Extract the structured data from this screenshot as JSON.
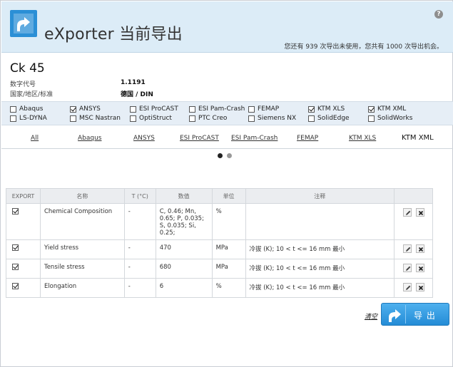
{
  "header": {
    "app_title": "eXporter 当前导出",
    "help_label": "?",
    "quota_text": "您还有 939 次导出未使用，您共有 1000 次导出机会。"
  },
  "material": {
    "name": "Ck 45",
    "fields": [
      {
        "label": "数字代号",
        "value": "1.1191"
      },
      {
        "label": "国家/地区/标准",
        "value": "德国 / DIN"
      }
    ]
  },
  "formats": [
    {
      "label": "Abaqus",
      "checked": false
    },
    {
      "label": "ANSYS",
      "checked": true
    },
    {
      "label": "ESI ProCAST",
      "checked": false
    },
    {
      "label": "ESI Pam-Crash",
      "checked": false
    },
    {
      "label": "FEMAP",
      "checked": false
    },
    {
      "label": "KTM XLS",
      "checked": true
    },
    {
      "label": "KTM XML",
      "checked": true
    },
    {
      "label": "LS-DYNA",
      "checked": false
    },
    {
      "label": "MSC Nastran",
      "checked": false
    },
    {
      "label": "OptiStruct",
      "checked": false
    },
    {
      "label": "PTC Creo",
      "checked": false
    },
    {
      "label": "Siemens NX",
      "checked": false
    },
    {
      "label": "SolidEdge",
      "checked": false
    },
    {
      "label": "SolidWorks",
      "checked": false
    }
  ],
  "tabs": [
    {
      "label": "All",
      "active": false
    },
    {
      "label": "Abaqus",
      "active": false
    },
    {
      "label": "ANSYS",
      "active": false
    },
    {
      "label": "ESI ProCAST",
      "active": false
    },
    {
      "label": "ESI Pam-Crash",
      "active": false
    },
    {
      "label": "FEMAP",
      "active": false
    },
    {
      "label": "KTM XLS",
      "active": false
    },
    {
      "label": "KTM XML",
      "active": true
    }
  ],
  "pager": {
    "pages": 2,
    "active_index": 0
  },
  "table": {
    "headers": [
      "EXPORT",
      "名称",
      "T (°C)",
      "数值",
      "单位",
      "注释",
      ""
    ],
    "rows": [
      {
        "export": true,
        "name": "Chemical Composition",
        "temp": "-",
        "value": "C, 0.46; Mn, 0.65; P, 0.035; S, 0.035; Si, 0.25;",
        "unit": "%",
        "note": ""
      },
      {
        "export": true,
        "name": "Yield stress",
        "temp": "-",
        "value": "470",
        "unit": "MPa",
        "note": "冷拔 (K); 10 < t <= 16 mm 最小"
      },
      {
        "export": true,
        "name": "Tensile stress",
        "temp": "-",
        "value": "680",
        "unit": "MPa",
        "note": "冷拔 (K); 10 < t <= 16 mm 最小"
      },
      {
        "export": true,
        "name": "Elongation",
        "temp": "-",
        "value": "6",
        "unit": "%",
        "note": "冷拔 (K); 10 < t <= 16 mm 最小"
      }
    ]
  },
  "actions": {
    "clear_label": "清空",
    "export_label": "导 出"
  },
  "colors": {
    "header_bg": "#dcecf7",
    "accent": "#2b8fd6",
    "panel_bg": "#e6eef6"
  },
  "icons": {
    "logo": "export-arrow-icon",
    "help": "help-icon",
    "edit": "pencil-icon",
    "delete": "close-icon"
  }
}
